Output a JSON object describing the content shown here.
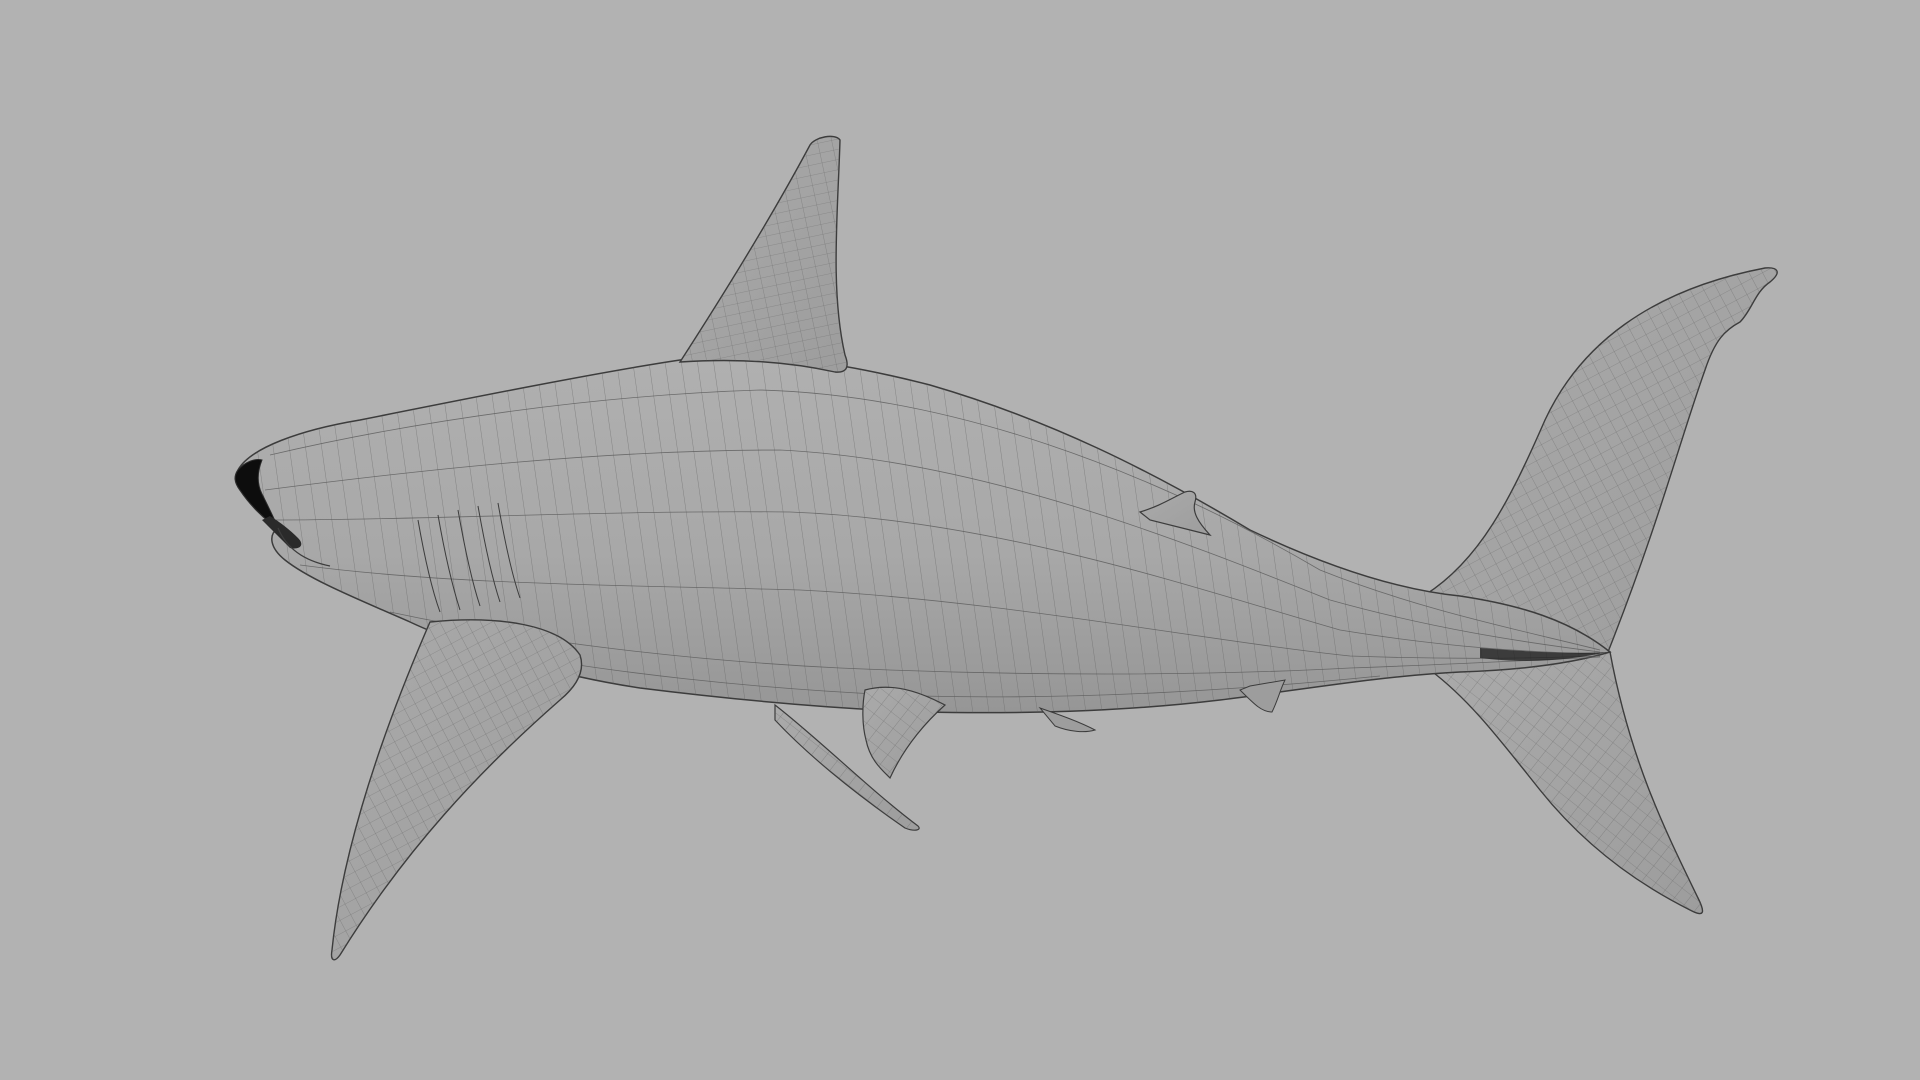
{
  "viewport": {
    "background_color": "#b2b2b2",
    "subject": "shark-wireframe-model",
    "colors": {
      "surface": "#a7a7a7",
      "surface_light": "#b0b0b0",
      "surface_dark": "#959595",
      "wire": "#5a5a5a",
      "outline": "#3c3c3c",
      "accent_dark": "#0d0d0d"
    }
  }
}
